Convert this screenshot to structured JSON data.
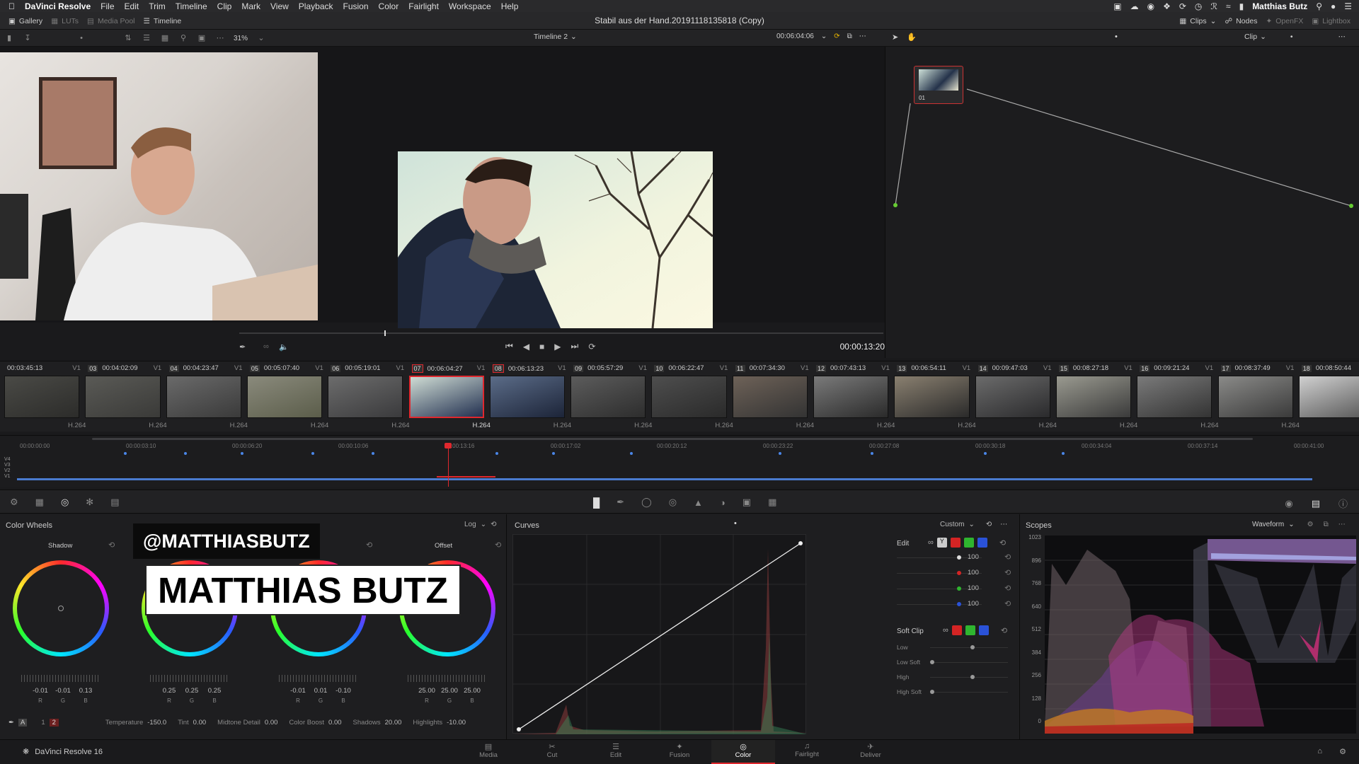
{
  "menubar": {
    "app_name": "DaVinci Resolve",
    "items": [
      "File",
      "Edit",
      "Trim",
      "Timeline",
      "Clip",
      "Mark",
      "View",
      "Playback",
      "Fusion",
      "Color",
      "Fairlight",
      "Workspace",
      "Help"
    ],
    "user": "Matthias Butz"
  },
  "toolbar": {
    "gallery": "Gallery",
    "luts": "LUTs",
    "media_pool": "Media Pool",
    "timeline": "Timeline",
    "project_title": "Stabil aus der Hand.20191118135818 (Copy)",
    "clips": "Clips",
    "nodes": "Nodes",
    "openfx": "OpenFX",
    "lightbox": "Lightbox"
  },
  "viewer": {
    "zoom": "31%",
    "timeline_name": "Timeline 2",
    "source_timecode": "00:06:04:06",
    "clip_mode": "Clip",
    "current_timecode": "00:00:13:20"
  },
  "node": {
    "label": "01"
  },
  "clips": [
    {
      "num": "",
      "tc": "00:03:45:13",
      "codec": "H.264"
    },
    {
      "num": "03",
      "tc": "00:04:02:09",
      "codec": "H.264"
    },
    {
      "num": "04",
      "tc": "00:04:23:47",
      "codec": "H.264"
    },
    {
      "num": "05",
      "tc": "00:05:07:40",
      "codec": "H.264"
    },
    {
      "num": "06",
      "tc": "00:05:19:01",
      "codec": "H.264"
    },
    {
      "num": "07",
      "tc": "00:06:04:27",
      "codec": "H.264"
    },
    {
      "num": "08",
      "tc": "00:06:13:23",
      "codec": "H.264"
    },
    {
      "num": "09",
      "tc": "00:05:57:29",
      "codec": "H.264"
    },
    {
      "num": "10",
      "tc": "00:06:22:47",
      "codec": "H.264"
    },
    {
      "num": "11",
      "tc": "00:07:34:30",
      "codec": "H.264"
    },
    {
      "num": "12",
      "tc": "00:07:43:13",
      "codec": "H.264"
    },
    {
      "num": "13",
      "tc": "00:06:54:11",
      "codec": "H.264"
    },
    {
      "num": "14",
      "tc": "00:09:47:03",
      "codec": "H.264"
    },
    {
      "num": "15",
      "tc": "00:08:27:18",
      "codec": "H.264"
    },
    {
      "num": "16",
      "tc": "00:09:21:24",
      "codec": "H.264"
    },
    {
      "num": "17",
      "tc": "00:08:37:49",
      "codec": "H.264"
    },
    {
      "num": "18",
      "tc": "00:08:50:44",
      "codec": "H.264"
    }
  ],
  "track_label": "V1",
  "ruler_ticks": [
    "00:00:00:00",
    "00:00:03:10",
    "00:00:06:20",
    "00:00:10:06",
    "00:00:13:16",
    "00:00:17:02",
    "00:00:20:12",
    "00:00:23:22",
    "00:00:27:08",
    "00:00:30:18",
    "00:00:34:04",
    "00:00:37:14",
    "00:00:41:00"
  ],
  "tracks": [
    "V4",
    "V3",
    "V2",
    "V1"
  ],
  "color_wheels": {
    "title": "Color Wheels",
    "mode": "Log",
    "wheels": [
      {
        "label": "Shadow",
        "values": [
          "-0.01",
          "-0.01",
          "0.13"
        ]
      },
      {
        "label": "",
        "values": [
          "0.25",
          "0.25",
          "0.25"
        ]
      },
      {
        "label": "ight",
        "values": [
          "-0.01",
          "0.01",
          "-0.10"
        ]
      },
      {
        "label": "Offset",
        "values": [
          "25.00",
          "25.00",
          "25.00"
        ]
      }
    ],
    "rgb": [
      "R",
      "G",
      "B"
    ],
    "bottom": {
      "page1": "1",
      "page2": "2",
      "temperature_label": "Temperature",
      "temperature": "-150.0",
      "tint_label": "Tint",
      "tint": "0.00",
      "midtone_label": "Midtone Detail",
      "midtone": "0.00",
      "boost_label": "Color Boost",
      "boost": "0.00",
      "shadows_label": "Shadows",
      "shadows": "20.00",
      "highlights_label": "Highlights",
      "highlights": "-10.00"
    }
  },
  "overlay": {
    "handle": "@MATTHIASBUTZ",
    "name": "MATTHIAS BUTZ"
  },
  "curves": {
    "title": "Curves",
    "preset": "Custom",
    "edit_label": "Edit",
    "channels": [
      "Y",
      "R",
      "G",
      "B"
    ],
    "intensity": [
      "100",
      "100",
      "100",
      "100"
    ],
    "soft_clip_label": "Soft Clip",
    "soft_clip_items": [
      "Low",
      "Low Soft",
      "High",
      "High Soft"
    ]
  },
  "scopes": {
    "title": "Scopes",
    "mode": "Waveform",
    "scale": [
      "1023",
      "896",
      "768",
      "640",
      "512",
      "384",
      "256",
      "128",
      "0"
    ]
  },
  "pages": [
    "Media",
    "Cut",
    "Edit",
    "Fusion",
    "Color",
    "Fairlight",
    "Deliver"
  ],
  "active_page": "Color",
  "footer_app": "DaVinci Resolve 16"
}
